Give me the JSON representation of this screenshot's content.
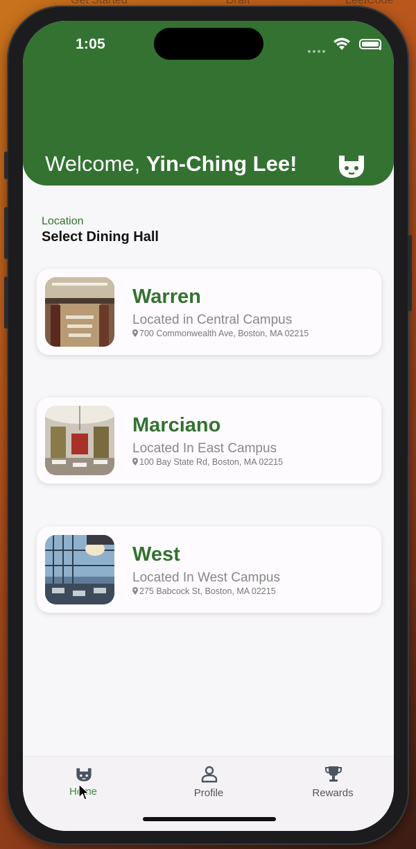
{
  "desktop": {
    "bg_labels": [
      "Get Started",
      "Draft",
      "LeetCode"
    ]
  },
  "status_bar": {
    "time": "1:05"
  },
  "header": {
    "welcome_prefix": "Welcome, ",
    "user_name": "Yin-Ching Lee!",
    "logo": "app-logo-icon"
  },
  "section": {
    "label": "Location",
    "title": "Select Dining Hall"
  },
  "halls": [
    {
      "name": "Warren",
      "campus": "Located in Central Campus",
      "address": "700 Commonwealth Ave, Boston, MA 02215"
    },
    {
      "name": "Marciano",
      "campus": "Located In East Campus",
      "address": "100 Bay State Rd, Boston, MA 02215"
    },
    {
      "name": "West",
      "campus": "Located In West Campus",
      "address": "275 Babcock St, Boston, MA 02215"
    }
  ],
  "tabs": [
    {
      "label": "Home",
      "icon": "home-logo-icon",
      "active": true
    },
    {
      "label": "Profile",
      "icon": "person-icon",
      "active": false
    },
    {
      "label": "Rewards",
      "icon": "trophy-icon",
      "active": false
    }
  ],
  "colors": {
    "brand_green": "#337231",
    "screen_bg": "#f7f6f8",
    "card_bg": "#fdfbfd"
  }
}
